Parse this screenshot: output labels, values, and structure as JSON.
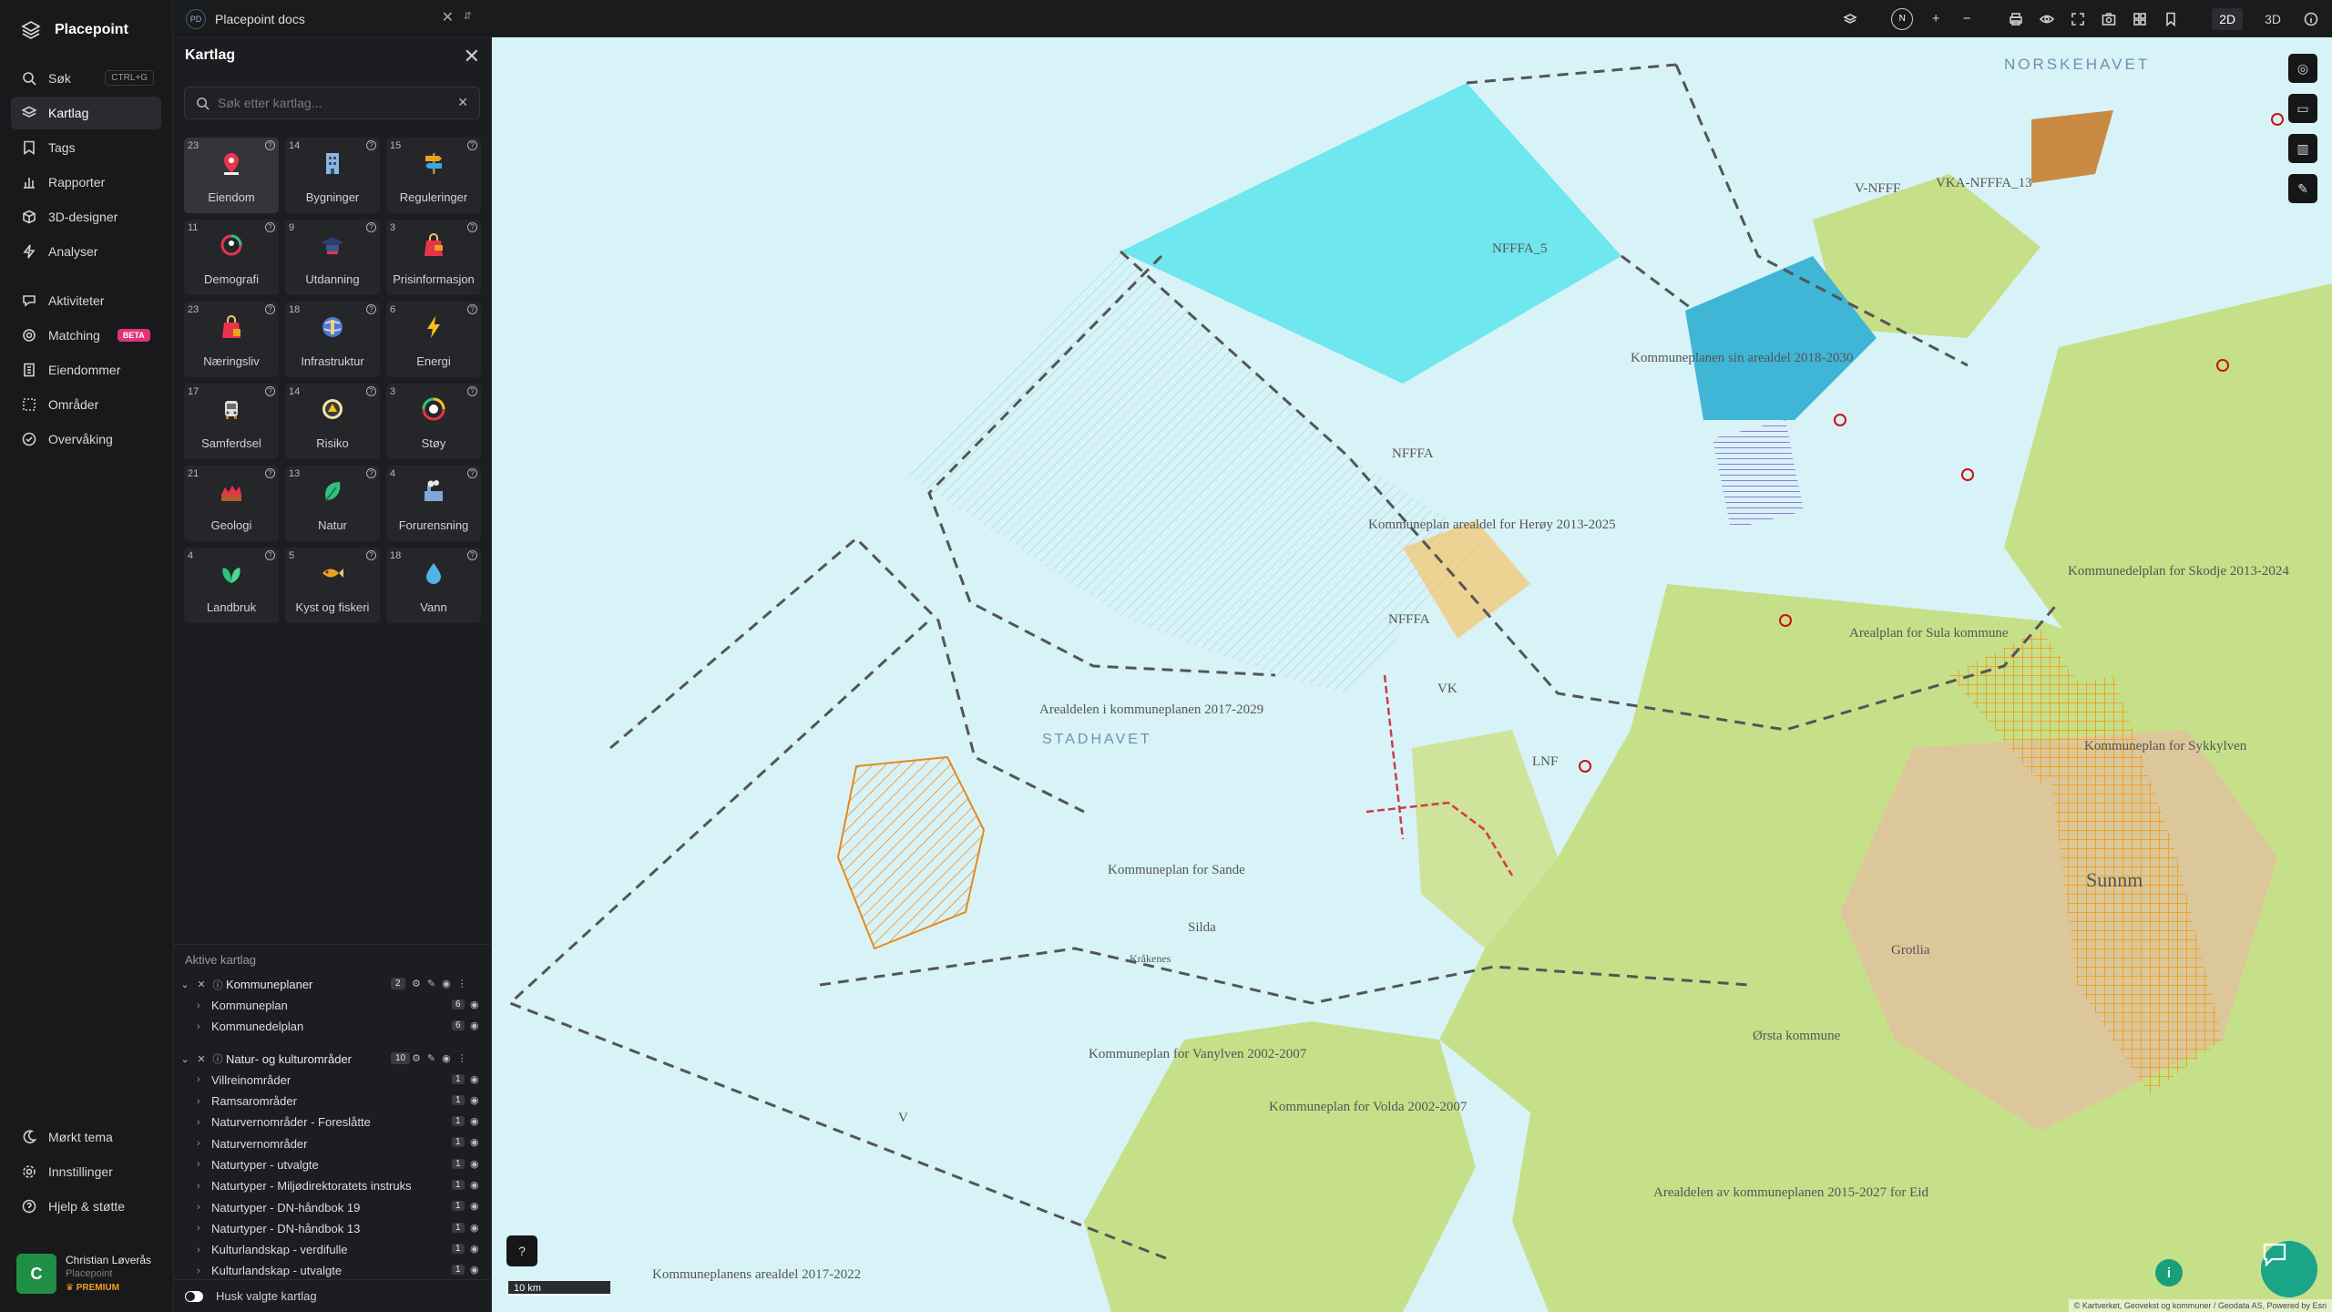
{
  "app": {
    "name": "Placepoint"
  },
  "nav": {
    "items": [
      {
        "label": "Søk",
        "icon": "search-icon",
        "shortcut": "CTRL+G"
      },
      {
        "label": "Kartlag",
        "icon": "layers-icon"
      },
      {
        "label": "Tags",
        "icon": "bookmark-icon"
      },
      {
        "label": "Rapporter",
        "icon": "chart-icon"
      },
      {
        "label": "3D-designer",
        "icon": "cube-icon"
      },
      {
        "label": "Analyser",
        "icon": "bolt-icon"
      },
      {
        "label": "Aktiviteter",
        "icon": "activity-icon"
      },
      {
        "label": "Matching",
        "icon": "matching-icon",
        "badge": "BETA"
      },
      {
        "label": "Eiendommer",
        "icon": "building-icon"
      },
      {
        "label": "Områder",
        "icon": "area-icon"
      },
      {
        "label": "Overvåking",
        "icon": "watch-icon"
      }
    ],
    "bottom": [
      {
        "label": "Mørkt tema",
        "icon": "moon-icon"
      },
      {
        "label": "Innstillinger",
        "icon": "gear-icon"
      },
      {
        "label": "Hjelp & støtte",
        "icon": "help-icon"
      }
    ],
    "user": {
      "initial": "C",
      "name": "Christian Løverås",
      "org": "Placepoint",
      "plan": "PREMIUM"
    }
  },
  "topbar": {
    "doc_badge": "PD",
    "doc_title": "Placepoint docs",
    "north": "N",
    "modes": [
      "2D",
      "3D"
    ],
    "active_mode": "2D"
  },
  "panel": {
    "title": "Kartlag",
    "search_placeholder": "Søk etter kartlag...",
    "categories": [
      {
        "count": "23",
        "label": "Eiendom",
        "icon": "pin-icon"
      },
      {
        "count": "14",
        "label": "Bygninger",
        "icon": "building-icon"
      },
      {
        "count": "15",
        "label": "Reguleringer",
        "icon": "signpost-icon"
      },
      {
        "count": "11",
        "label": "Demografi",
        "icon": "demography-icon"
      },
      {
        "count": "9",
        "label": "Utdanning",
        "icon": "education-icon"
      },
      {
        "count": "3",
        "label": "Prisinformasjon",
        "icon": "price-icon"
      },
      {
        "count": "23",
        "label": "Næringsliv",
        "icon": "business-icon"
      },
      {
        "count": "18",
        "label": "Infrastruktur",
        "icon": "infrastructure-icon"
      },
      {
        "count": "6",
        "label": "Energi",
        "icon": "energy-icon"
      },
      {
        "count": "17",
        "label": "Samferdsel",
        "icon": "transport-icon"
      },
      {
        "count": "14",
        "label": "Risiko",
        "icon": "risk-icon"
      },
      {
        "count": "3",
        "label": "Støy",
        "icon": "noise-icon"
      },
      {
        "count": "21",
        "label": "Geologi",
        "icon": "geology-icon"
      },
      {
        "count": "13",
        "label": "Natur",
        "icon": "nature-icon"
      },
      {
        "count": "4",
        "label": "Forurensning",
        "icon": "pollution-icon"
      },
      {
        "count": "4",
        "label": "Landbruk",
        "icon": "agriculture-icon"
      },
      {
        "count": "5",
        "label": "Kyst og fiskeri",
        "icon": "fish-icon"
      },
      {
        "count": "18",
        "label": "Vann",
        "icon": "water-icon"
      }
    ],
    "active_title": "Aktive kartlag",
    "groups": [
      {
        "name": "Kommuneplaner",
        "count": "2",
        "layers": [
          {
            "name": "Kommuneplan",
            "count": "6"
          },
          {
            "name": "Kommunedelplan",
            "count": "6"
          }
        ]
      },
      {
        "name": "Natur- og kulturområder",
        "count": "10",
        "layers": [
          {
            "name": "Villreinområder",
            "count": "1"
          },
          {
            "name": "Ramsarområder",
            "count": "1"
          },
          {
            "name": "Naturvernområder - Foreslåtte",
            "count": "1"
          },
          {
            "name": "Naturvernområder",
            "count": "1"
          },
          {
            "name": "Naturtyper - utvalgte",
            "count": "1"
          },
          {
            "name": "Naturtyper - Miljødirektoratets instruks",
            "count": "1"
          },
          {
            "name": "Naturtyper - DN-håndbok 19",
            "count": "1"
          },
          {
            "name": "Naturtyper - DN-håndbok 13",
            "count": "1"
          },
          {
            "name": "Kulturlandskap - verdifulle",
            "count": "1"
          },
          {
            "name": "Kulturlandskap - utvalgte",
            "count": "1"
          }
        ]
      }
    ],
    "remember_label": "Husk valgte kartlag"
  },
  "map": {
    "scale": "10 km",
    "labels": {
      "sea1": "NORSKEHAVET",
      "sea2": "STADHAVET",
      "l1": "NFFFA_5",
      "l2": "NFFFA",
      "l3": "Kommuneplanen sin arealdel 2018-2030",
      "l4": "Kommuneplan arealdel for Herøy 2013-2025",
      "l5": "Arealdelen i kommuneplanen 2017-2029",
      "l6": "Kommuneplan for Sande",
      "l7": "Kommuneplan for Vanylven 2002-2007",
      "l8": "Kommuneplan for Volda 2002-2007",
      "l9": "Kommuneplanens arealdel 2017-2022",
      "l10": "Arealdelen av kommuneplanen 2015-2027 for Eid",
      "l11": "Arealplan for Sula kommune",
      "l12": "Kommuneplan for Sykkylven",
      "l13": "Kommunedelplan for Skodje 2013-2024",
      "l14": "V-NFFF",
      "l15": "VKA-NFFFA_13",
      "l16": "V",
      "l17": "NFFFA",
      "l18": "Grotlia",
      "l19": "Sunnm",
      "l20": "Ørsta kommune",
      "l21": "Kråkenes",
      "l22": "Silda",
      "l23": "VK",
      "l24": "LNF"
    },
    "attribution": "© Kartverket, Geovekst og kommuner / Geodata AS, Powered by Esri"
  }
}
